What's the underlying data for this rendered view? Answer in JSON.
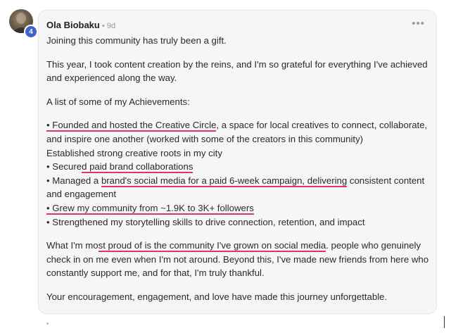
{
  "post": {
    "author": "Ola Biobaku",
    "separator": " • ",
    "age": "9d",
    "level": "4",
    "more_label": "•••",
    "paragraphs": {
      "p1": "Joining this community has truly been a gift.",
      "p2": "This year, I took content creation by the reins, and I'm so grateful for everything I've achieved and experienced along the way.",
      "p3": "A list of some of my Achievements:",
      "list": {
        "l1a": "• Founded and hosted the Creative Circle",
        "l1b": ", a space for local creatives to connect, collaborate, and inspire one another (worked with some of the creators in this community)",
        "l2": "Established strong creative roots in my city",
        "l3a": "• Secure",
        "l3b": "d paid brand collaborations",
        "l4a": "• Managed a ",
        "l4b": "brand's social media for a paid 6-week campaign, delivering",
        "l4c": " consistent content and engagement",
        "l5": "• Grew my community from ~1.9K to 3K+ followers",
        "l6": "• Strengthened my storytelling skills to drive connection, retention, and impact"
      },
      "p5a": "What I'm mo",
      "p5b": "st proud of is the community I've grown on social media",
      "p5c": ". people who genuinely check in on me even when I'm not around. Beyond this, I've made new friends from here who constantly support me, and for that, I'm truly thankful.",
      "p6": "Your encouragement, engagement, and love have made this journey unforgettable."
    }
  },
  "colors": {
    "highlight": "#e0326b",
    "badge": "#3e63c9",
    "card_bg": "#f6f6f7"
  }
}
